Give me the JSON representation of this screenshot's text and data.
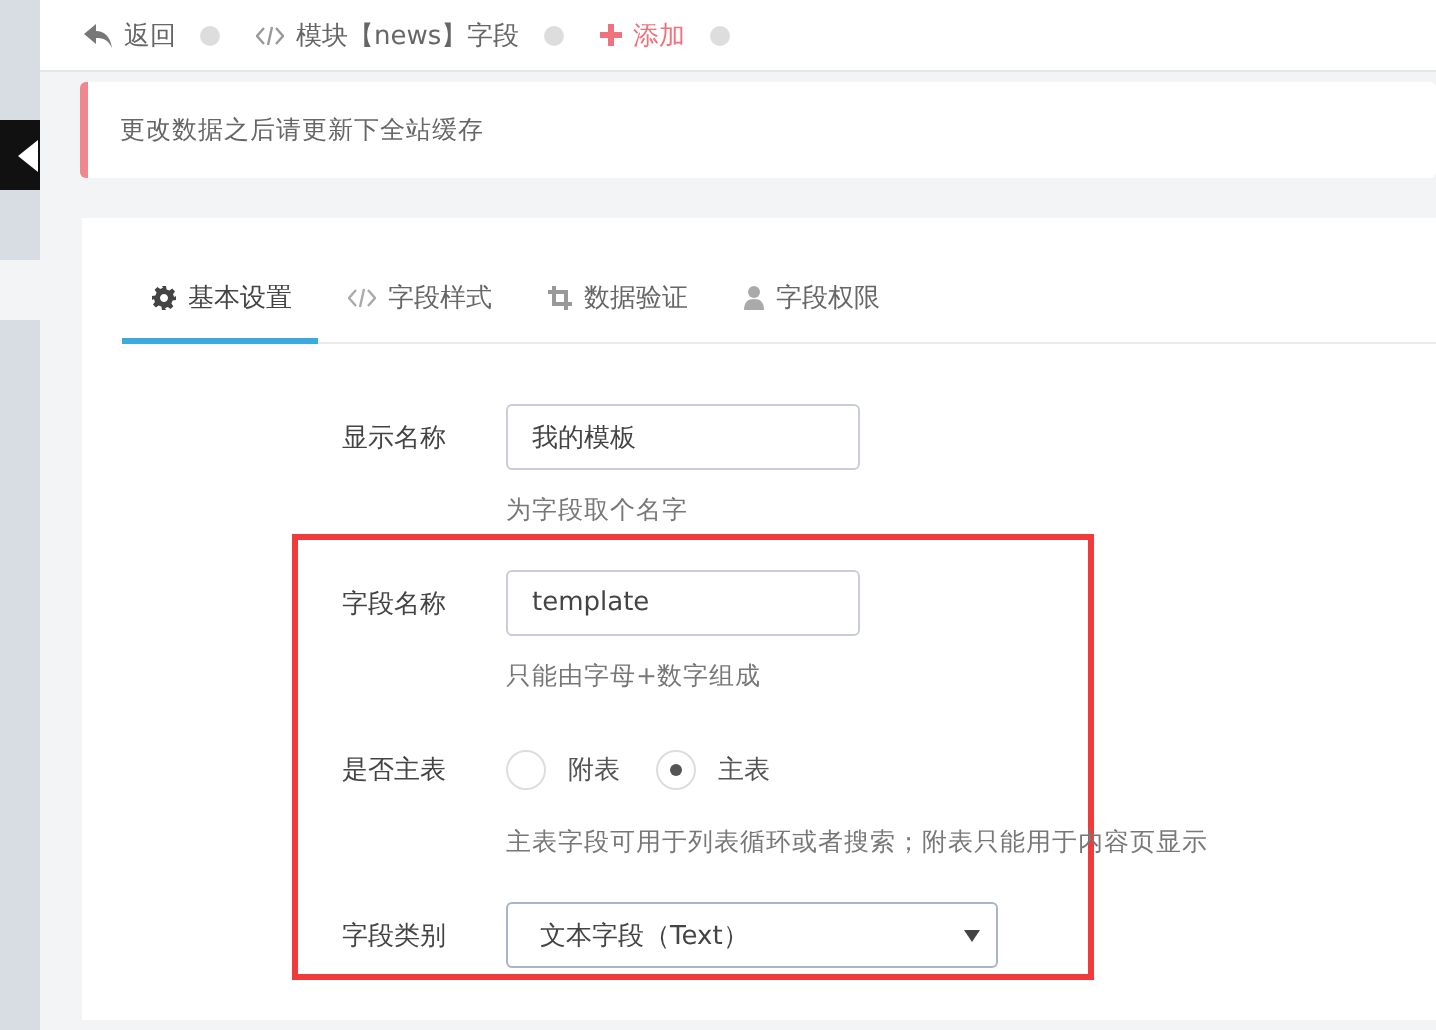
{
  "breadcrumb": [
    {
      "kind": "back",
      "label": "返回"
    },
    {
      "kind": "code",
      "label": "模块【news】字段"
    },
    {
      "kind": "add",
      "label": "添加"
    }
  ],
  "notice": "更改数据之后请更新下全站缓存",
  "tabs": [
    {
      "label": "基本设置",
      "selected": true
    },
    {
      "label": "字段样式",
      "selected": false
    },
    {
      "label": "数据验证",
      "selected": false
    },
    {
      "label": "字段权限",
      "selected": false
    }
  ],
  "form": [
    {
      "kind": "text",
      "label": "显示名称",
      "value": "我的模板",
      "help": "为字段取个名字"
    },
    {
      "kind": "text",
      "label": "字段名称",
      "value": "template",
      "help": "只能由字母+数字组成"
    },
    {
      "kind": "radio",
      "label": "是否主表",
      "options": [
        {
          "label": "附表",
          "selected": false
        },
        {
          "label": "主表",
          "selected": true
        }
      ],
      "help": "主表字段可用于列表循环或者搜索；附表只能用于内容页显示"
    },
    {
      "kind": "select",
      "label": "字段类别",
      "value": "文本字段（Text）"
    }
  ],
  "annotation": {
    "kind": "frame"
  }
}
